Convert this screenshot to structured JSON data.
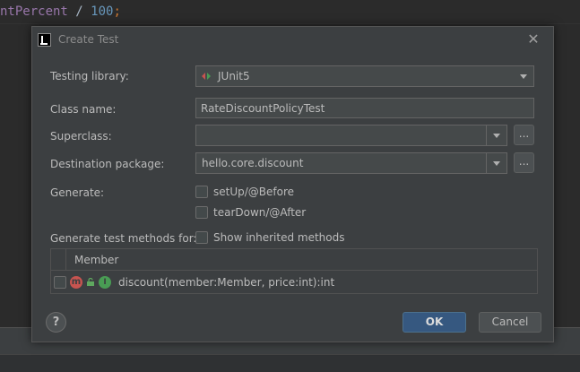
{
  "editor": {
    "code_var": "ntPercent",
    "code_op": " / ",
    "code_num": "100",
    "code_semi": ";"
  },
  "dialog": {
    "title": "Create Test",
    "fields": {
      "testing_library_label": "Testing library:",
      "testing_library_value": "JUnit5",
      "class_name_label": "Class name:",
      "class_name_value": "RateDiscountPolicyTest",
      "superclass_label": "Superclass:",
      "superclass_value": "",
      "destination_package_label": "Destination package:",
      "destination_package_value": "hello.core.discount",
      "browse_label": "..."
    },
    "generate": {
      "label": "Generate:",
      "setup_label": "setUp/@Before",
      "teardown_label": "tearDown/@After"
    },
    "methods": {
      "label": "Generate test methods for:",
      "show_inherited_label": "Show inherited methods",
      "column_header": "Member",
      "rows": [
        {
          "icon_letter": "m",
          "badge_letter": "I",
          "text": "discount(member:Member, price:int):int"
        }
      ]
    },
    "buttons": {
      "help": "?",
      "ok": "OK",
      "cancel": "Cancel"
    }
  },
  "colors": {
    "dialog_bg": "#3c3f41",
    "field_bg": "#45494a",
    "ok_button": "#365880",
    "method_icon": "#c75450",
    "inherit_badge": "#499c54"
  },
  "icons": [
    "intellij-app-icon",
    "close-icon",
    "junit-icon",
    "dropdown-arrow-icon",
    "method-icon",
    "lock-icon",
    "implemented-interface-icon",
    "help-icon"
  ]
}
